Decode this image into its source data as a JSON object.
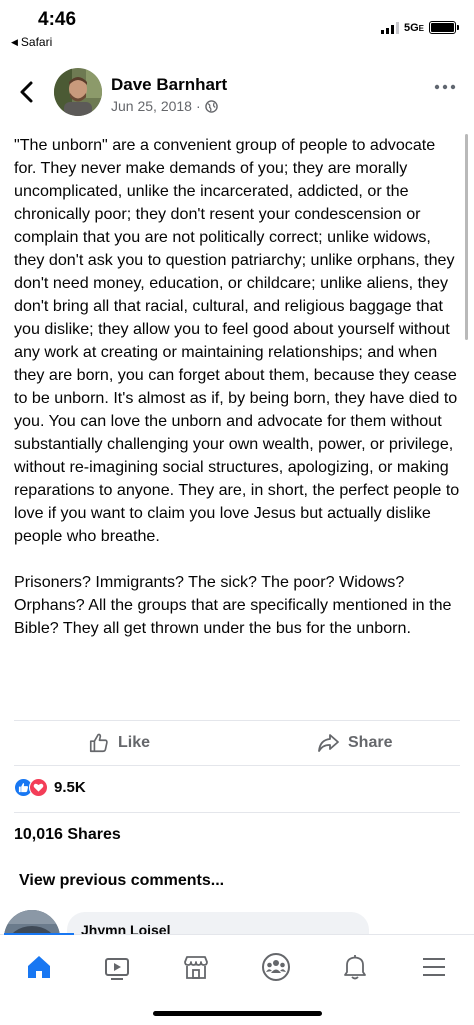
{
  "status_bar": {
    "time": "4:46",
    "back_app": "Safari",
    "network": "5G",
    "network_suffix": "E"
  },
  "post": {
    "author": "Dave Barnhart",
    "date": "Jun 25, 2018",
    "separator": "·",
    "privacy_icon": "globe-icon",
    "paragraphs": [
      "\"The unborn\" are a convenient group of people to advocate for. They never make demands of you; they are morally uncomplicated, unlike the incarcerated, addicted, or the chronically poor; they don't resent your condescension or complain that you are not politically correct; unlike widows, they don't ask you to question patriarchy; unlike orphans, they don't need money, education, or childcare; unlike aliens, they don't bring all that racial, cultural, and religious baggage that you dislike; they allow you to feel good about yourself without any work at creating or maintaining relationships; and when they are born, you can forget about them, because they cease to be unborn. It's almost as if, by being born, they have died to you. You can love the unborn and advocate for them without substantially challenging your own wealth, power, or privilege, without re-imagining social structures, apologizing, or making reparations to anyone. They are, in short, the perfect people to love if you want to claim you love Jesus but actually dislike people who breathe.",
      "Prisoners? Immigrants? The sick? The poor? Widows? Orphans? All the groups that are specifically mentioned in the Bible? They all get thrown under the bus for the unborn."
    ]
  },
  "actions": {
    "like_label": "Like",
    "share_label": "Share"
  },
  "stats": {
    "reaction_count": "9.5K",
    "shares": "10,016 Shares"
  },
  "comments": {
    "view_previous": "View previous comments...",
    "first_commenter": "Jhymn Loisel"
  },
  "bottom_nav": {
    "items": [
      "home-icon",
      "watch-icon",
      "marketplace-icon",
      "groups-icon",
      "notifications-icon",
      "menu-icon"
    ],
    "active": "home-icon"
  },
  "colors": {
    "accent": "#1877f2",
    "love": "#f33e58",
    "secondary_text": "#65676b",
    "divider": "#e4e6eb"
  }
}
